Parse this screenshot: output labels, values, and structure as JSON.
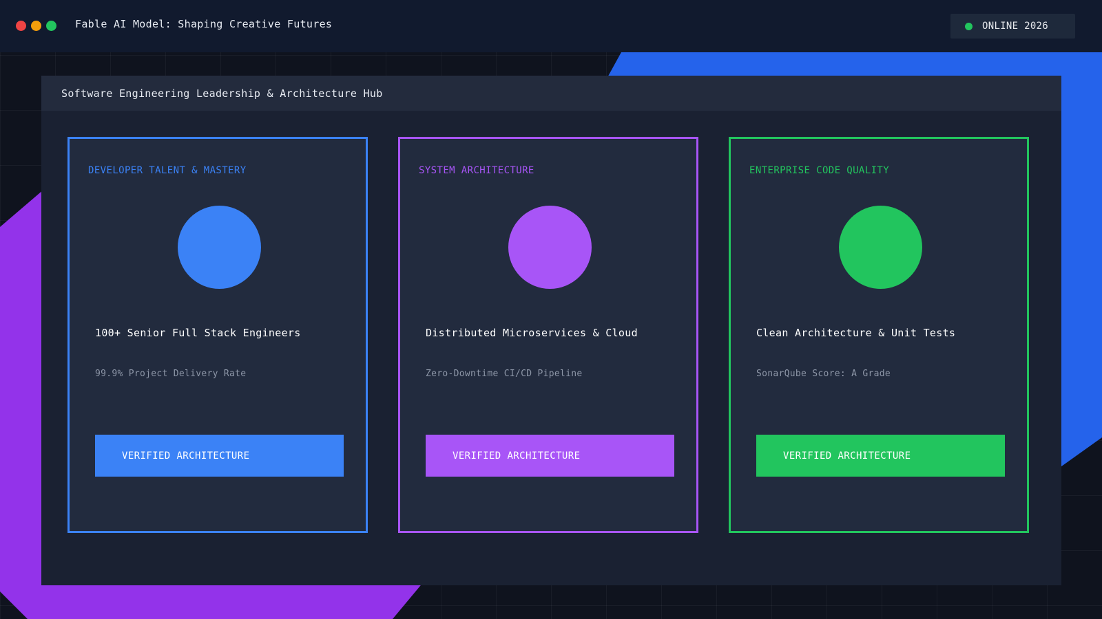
{
  "window": {
    "title": "Fable AI Model: Shaping Creative Futures",
    "controls": [
      {
        "name": "close",
        "color": "#ef4444"
      },
      {
        "name": "minimize",
        "color": "#f59e0b"
      },
      {
        "name": "maximize",
        "color": "#22c55e"
      }
    ]
  },
  "status": {
    "label": "ONLINE 2026",
    "dot_color": "#22c55e"
  },
  "panel": {
    "title": "Software Engineering Leadership & Architecture Hub"
  },
  "colors": {
    "decor_blue": "#2563eb",
    "decor_purple": "#9333ea"
  },
  "cards": [
    {
      "label": "DEVELOPER TALENT & MASTERY",
      "heading": "100+ Senior Full Stack Engineers",
      "subtext": "99.9% Project Delivery Rate",
      "button_label": "VERIFIED ARCHITECTURE",
      "accent": "#3b82f6"
    },
    {
      "label": "SYSTEM ARCHITECTURE",
      "heading": "Distributed Microservices & Cloud",
      "subtext": "Zero-Downtime CI/CD Pipeline",
      "button_label": "VERIFIED ARCHITECTURE",
      "accent": "#a855f7"
    },
    {
      "label": "ENTERPRISE CODE QUALITY",
      "heading": "Clean Architecture & Unit Tests",
      "subtext": "SonarQube Score: A Grade",
      "button_label": "VERIFIED ARCHITECTURE",
      "accent": "#22c55e"
    }
  ]
}
